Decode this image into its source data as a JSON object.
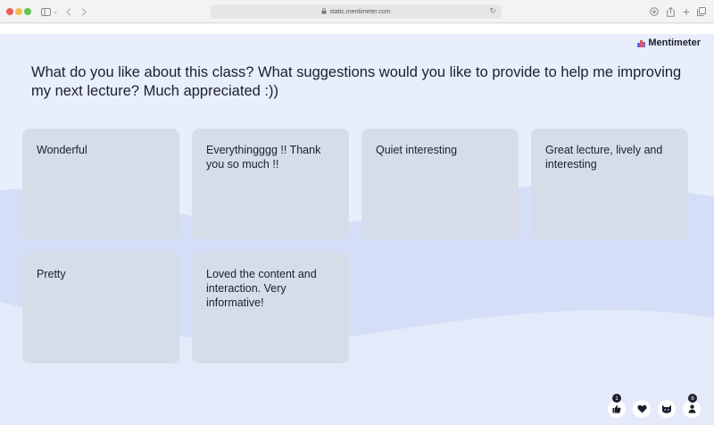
{
  "browser": {
    "url": "static.mentimeter.com"
  },
  "brand": {
    "name": "Mentimeter",
    "colors": {
      "accent_red": "#e0585a",
      "accent_blue": "#5a6cf0",
      "accent_purple": "#8e63e0"
    }
  },
  "question": "What do you like about this class? What suggestions would you like to provide to help me improving my next lecture? Much appreciated :))",
  "responses": [
    "Wonderful",
    "Everythingggg !! Thank you so much !!",
    "Quiet interesting",
    "Great lecture, lively and interesting",
    "Pretty",
    "Loved the content and interaction. Very informative!"
  ],
  "reactions": {
    "thumbs_up": {
      "icon": "thumbs-up-icon",
      "count": "1"
    },
    "heart": {
      "icon": "heart-icon"
    },
    "cat": {
      "icon": "cat-icon"
    },
    "participants": {
      "icon": "person-icon",
      "count": "6"
    }
  }
}
